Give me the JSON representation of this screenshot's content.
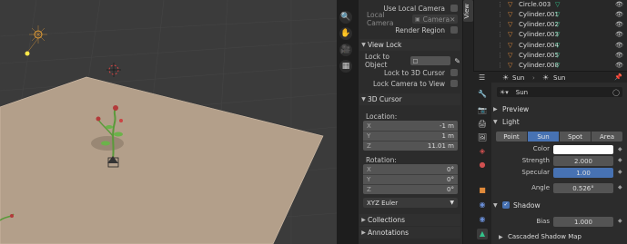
{
  "viewport_overlay": {
    "icons": [
      "magnify-icon",
      "hand-icon",
      "camera-icon",
      "grid-icon"
    ]
  },
  "npanel": {
    "tab_label": "View",
    "use_local_camera": "Use Local Camera",
    "local_camera_label": "Local Camera",
    "local_camera_value": "Camera",
    "render_region": "Render Region",
    "view_lock_header": "View Lock",
    "lock_to_object": "Lock to Object",
    "lock_to_3d_cursor": "Lock to 3D Cursor",
    "lock_camera_to_view": "Lock Camera to View",
    "cursor_header": "3D Cursor",
    "location_label": "Location:",
    "loc_x_label": "X",
    "loc_x": "-1 m",
    "loc_y_label": "Y",
    "loc_y": "1 m",
    "loc_z_label": "Z",
    "loc_z": "11.01 m",
    "rotation_label": "Rotation:",
    "rot_x_label": "X",
    "rot_x": "0°",
    "rot_y_label": "Y",
    "rot_y": "0°",
    "rot_z_label": "Z",
    "rot_z": "0°",
    "rotation_mode": "XYZ Euler",
    "collections": "Collections",
    "annotations": "Annotations"
  },
  "outliner": {
    "rows": [
      {
        "name": "Circle.003"
      },
      {
        "name": "Cylinder.001"
      },
      {
        "name": "Cylinder.002"
      },
      {
        "name": "Cylinder.003"
      },
      {
        "name": "Cylinder.004"
      },
      {
        "name": "Cylinder.005"
      },
      {
        "name": "Cylinder.008"
      }
    ]
  },
  "properties": {
    "object_name": "Sun",
    "data_name": "Sun",
    "data_field": "Sun",
    "preview_header": "Preview",
    "light_header": "Light",
    "light_types": [
      "Point",
      "Sun",
      "Spot",
      "Area"
    ],
    "active_type": "Sun",
    "color_label": "Color",
    "strength_label": "Strength",
    "strength": "2.000",
    "specular_label": "Specular",
    "specular": "1.00",
    "angle_label": "Angle",
    "angle": "0.526°",
    "shadow_header": "Shadow",
    "bias_label": "Bias",
    "bias": "1.000",
    "cascaded_header": "Cascaded Shadow Map"
  },
  "colors": {
    "accent": "#4772b3",
    "floor": "#b39f8a",
    "viewport_bg": "#3b3b3b",
    "panel_bg": "#2c2c2c"
  }
}
